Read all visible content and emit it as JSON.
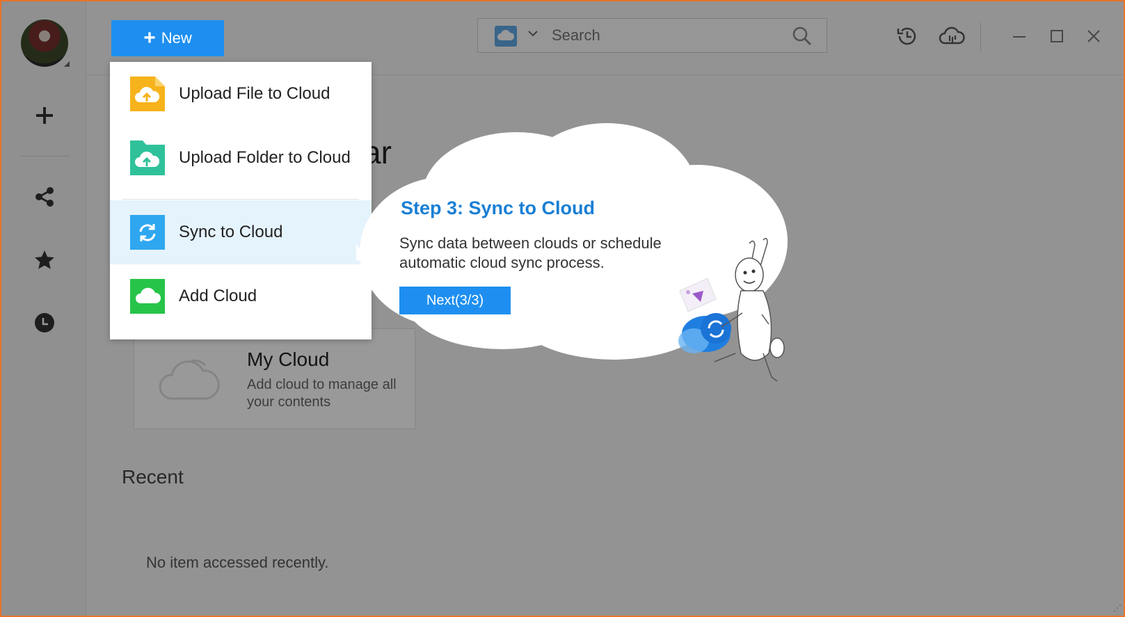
{
  "sidebar": {
    "avatar_alt": "",
    "items": [
      {
        "name": "add",
        "icon": "plus-icon"
      },
      {
        "name": "share",
        "icon": "share-icon"
      },
      {
        "name": "favorites",
        "icon": "star-icon"
      },
      {
        "name": "recent",
        "icon": "clock-icon"
      }
    ]
  },
  "toolbar": {
    "new_label": "New",
    "search_placeholder": "Search",
    "icons": [
      "history-icon",
      "cloud-sync-icon"
    ],
    "window_controls": [
      "minimize-icon",
      "maximize-icon",
      "close-icon"
    ]
  },
  "main": {
    "title_fragment": "ar",
    "cloud_card": {
      "title": "My Cloud",
      "description": "Add cloud to manage all your contents"
    },
    "recent_title": "Recent",
    "empty_message": "No item accessed recently."
  },
  "menu": {
    "items": [
      {
        "label": "Upload File to Cloud",
        "icon": "upload-file-icon",
        "color": "#f7b31c"
      },
      {
        "label": "Upload Folder to Cloud",
        "icon": "upload-folder-icon",
        "color": "#2fc29a"
      },
      {
        "label": "Sync to Cloud",
        "icon": "sync-icon",
        "color": "#2fa7f0"
      },
      {
        "label": "Add Cloud",
        "icon": "add-cloud-icon",
        "color": "#27c44a"
      }
    ],
    "active_index": 2
  },
  "tooltip": {
    "title": "Step 3: Sync to Cloud",
    "description": "Sync data between clouds or schedule automatic cloud sync process.",
    "next_label": "Next(3/3)"
  },
  "colors": {
    "accent": "#1e8ff0",
    "frame_border": "#e8732a",
    "title_blue": "#1a7fd4"
  }
}
